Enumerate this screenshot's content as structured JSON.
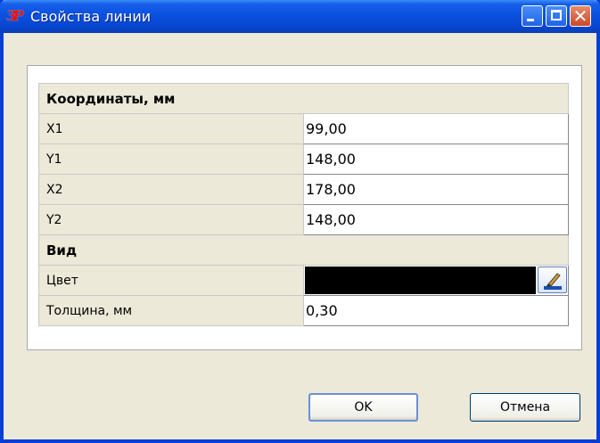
{
  "window": {
    "title": "Свойства линии",
    "icon": "app-logo-icon",
    "icon_text": "ЗР",
    "controls": [
      "minimize-icon",
      "maximize-icon",
      "close-icon"
    ]
  },
  "sections": {
    "coordinates": {
      "header": "Координаты, мм",
      "rows": [
        {
          "label": "X1",
          "value": "99,00"
        },
        {
          "label": "Y1",
          "value": "148,00"
        },
        {
          "label": "X2",
          "value": "178,00"
        },
        {
          "label": "Y2",
          "value": "148,00"
        }
      ]
    },
    "view": {
      "header": "Вид",
      "color_label": "Цвет",
      "color_value": "#000000",
      "color_button_icon": "paint-brush-icon",
      "thickness_label": "Толщина, мм",
      "thickness_value": "0,30"
    }
  },
  "buttons": {
    "ok": "OK",
    "cancel": "Отмена"
  }
}
